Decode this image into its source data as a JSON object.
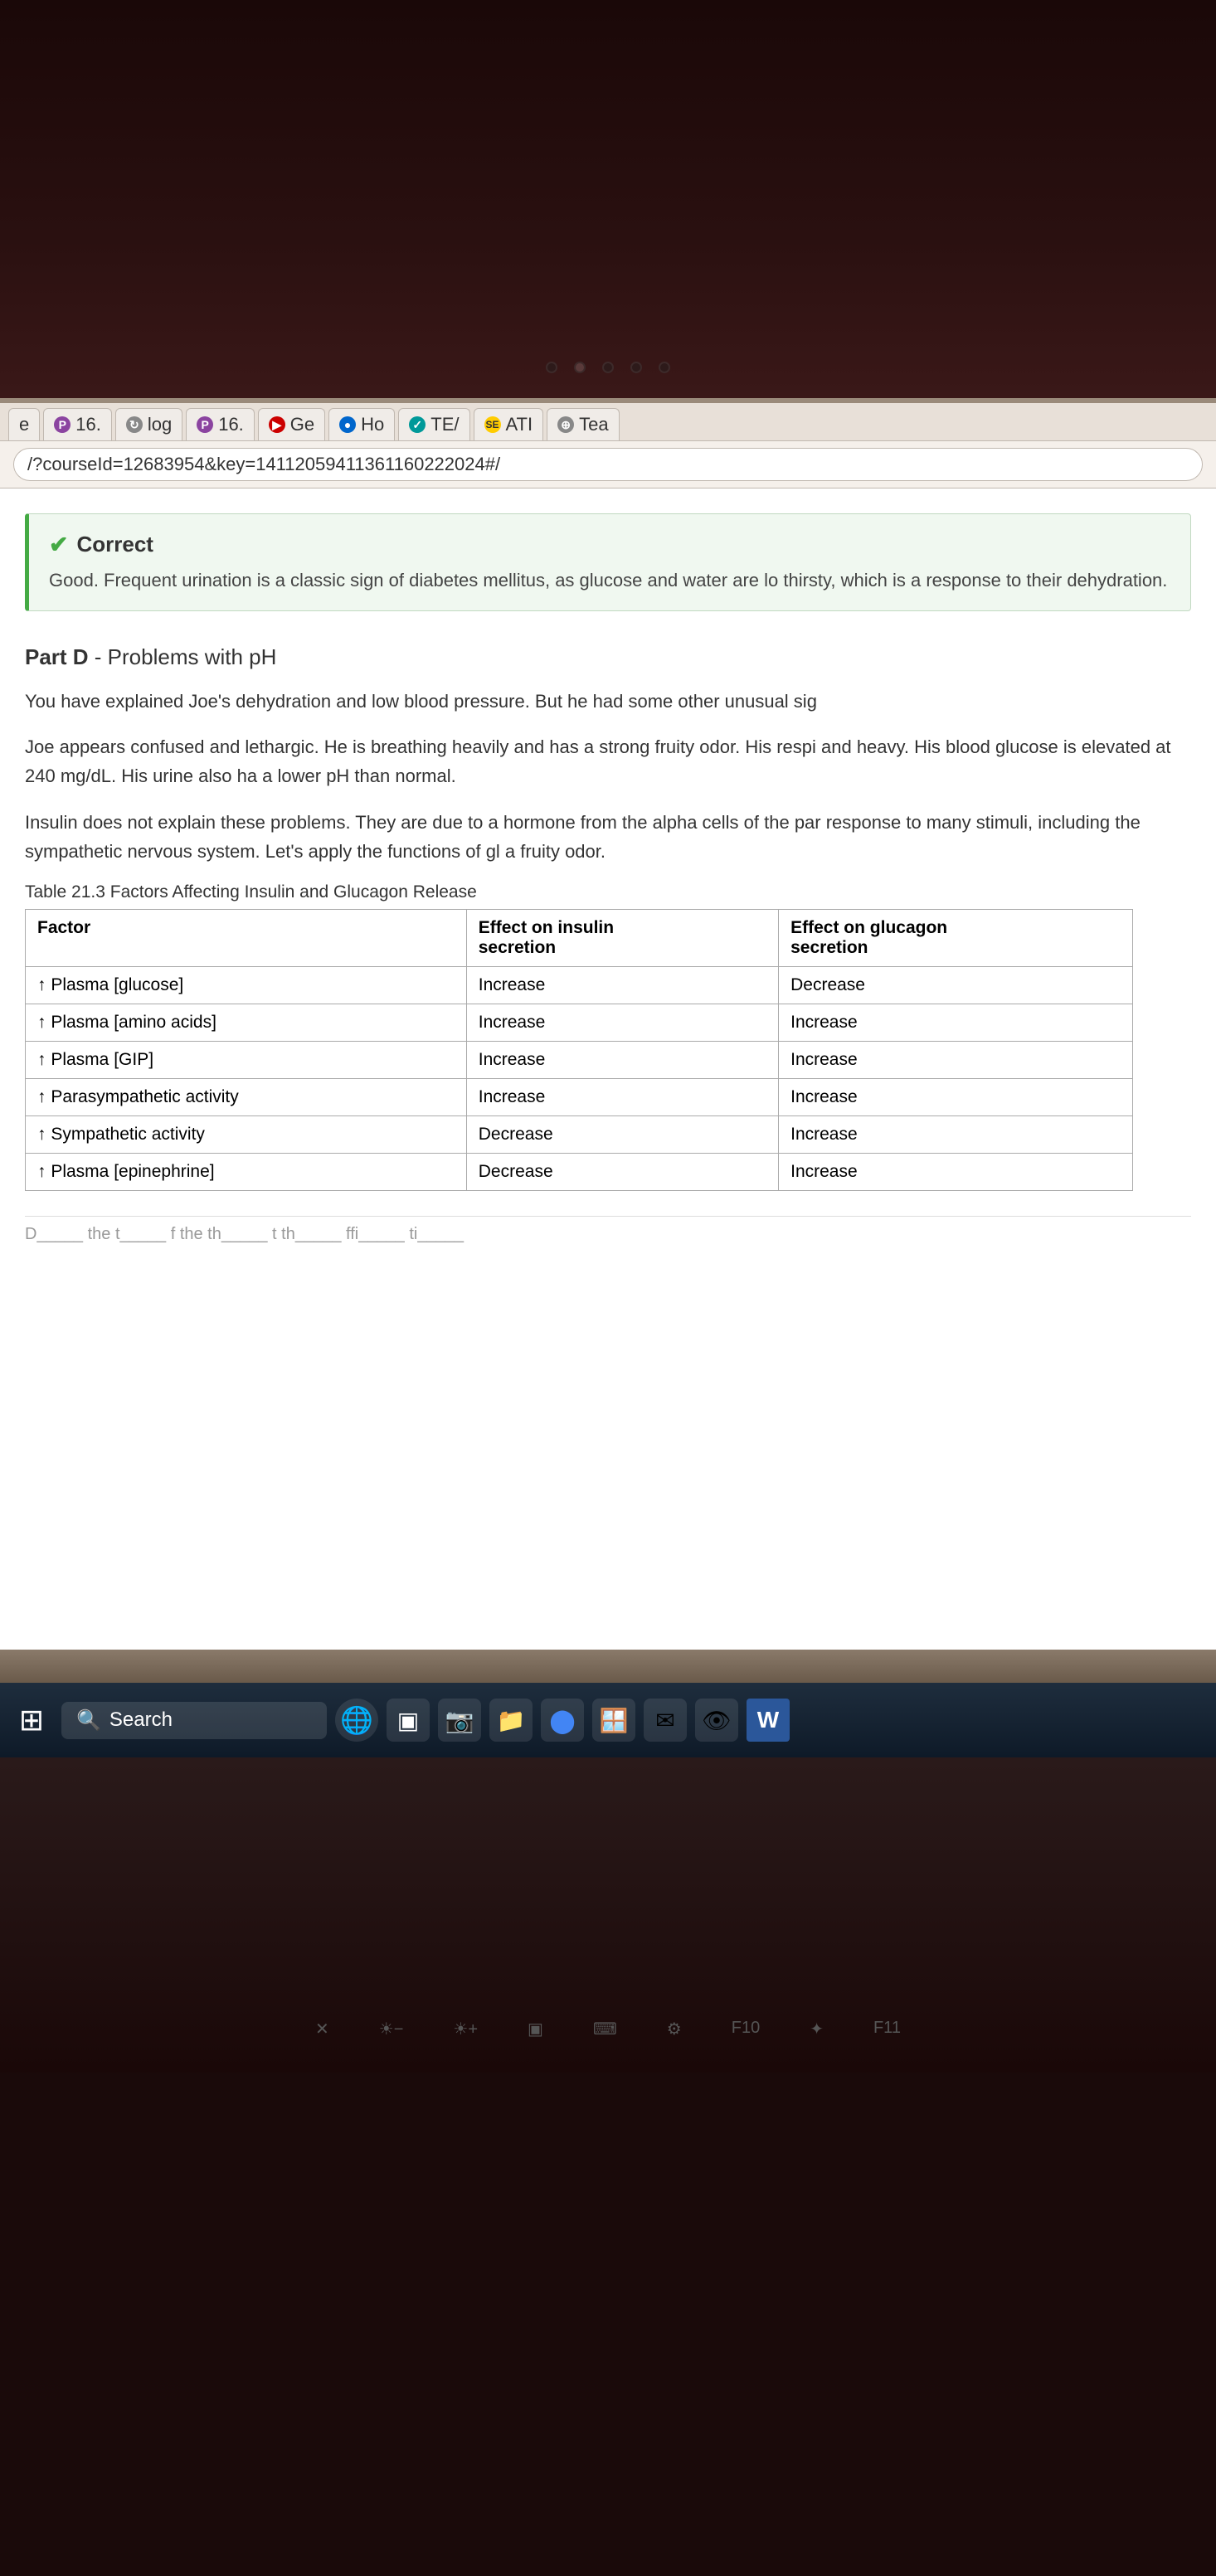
{
  "laptop": {
    "camera_area": "camera"
  },
  "browser": {
    "tabs": [
      {
        "id": "tab-e",
        "label": "e",
        "icon_type": "text",
        "icon_char": "e"
      },
      {
        "id": "tab-p1",
        "label": "16.",
        "icon_type": "purple",
        "icon_char": "P"
      },
      {
        "id": "tab-log",
        "label": "log",
        "icon_type": "globe",
        "icon_char": "↻"
      },
      {
        "id": "tab-p2",
        "label": "16.",
        "icon_type": "purple",
        "icon_char": "P"
      },
      {
        "id": "tab-yt",
        "label": "Ge",
        "icon_type": "red",
        "icon_char": "▶"
      },
      {
        "id": "tab-ho",
        "label": "Ho",
        "icon_type": "blue",
        "icon_char": "●"
      },
      {
        "id": "tab-te",
        "label": "TE/",
        "icon_type": "teal",
        "icon_char": "✓"
      },
      {
        "id": "tab-se",
        "label": "ATI",
        "icon_type": "se",
        "icon_char": "SE"
      },
      {
        "id": "tab-tea",
        "label": "Tea",
        "icon_type": "globe",
        "icon_char": "⊕"
      }
    ],
    "address": "/?courseId=12683954&key=14112059411361160222024#/"
  },
  "correct_banner": {
    "title": "Correct",
    "text": "Good. Frequent urination is a classic sign of diabetes mellitus, as glucose and water are lo thirsty, which is a response to their dehydration."
  },
  "part_d": {
    "heading_bold": "Part D",
    "heading_rest": " - Problems with pH",
    "paragraphs": [
      "You have explained Joe's dehydration and low blood pressure. But he had some other unusual sig",
      "Joe appears confused and lethargic. He is breathing heavily and has a strong fruity odor. His respi and heavy. His blood glucose is elevated at 240 mg/dL. His urine also ha a lower pH than normal.",
      "Insulin does not explain these problems. They are due to a hormone from the alpha cells of the par response to many stimuli, including the sympathetic nervous system. Let's apply the functions of gl a fruity odor."
    ]
  },
  "table": {
    "caption": "Table 21.3 Factors Affecting Insulin and Glucagon Release",
    "headers": [
      "Factor",
      "Effect on insulin secretion",
      "Effect on glucagon secretion"
    ],
    "rows": [
      [
        "↑ Plasma [glucose]",
        "Increase",
        "Decrease"
      ],
      [
        "↑ Plasma [amino acids]",
        "Increase",
        "Increase"
      ],
      [
        "↑ Plasma [GIP]",
        "Increase",
        "Increase"
      ],
      [
        "↑ Parasympathetic activity",
        "Increase",
        "Increase"
      ],
      [
        "↑ Sympathetic activity",
        "Decrease",
        "Increase"
      ],
      [
        "↑ Plasma [epinephrine]",
        "Decrease",
        "Increase"
      ]
    ]
  },
  "partial_bottom": "D the t f the th t th ffi ti",
  "taskbar": {
    "search_placeholder": "Search",
    "icons": [
      {
        "name": "windows",
        "char": "⊞"
      },
      {
        "name": "search-widget",
        "char": "🌐"
      },
      {
        "name": "task-view",
        "char": "▣"
      },
      {
        "name": "video-call",
        "char": "📷"
      },
      {
        "name": "files",
        "char": "📁"
      },
      {
        "name": "chrome",
        "char": "●"
      },
      {
        "name": "store",
        "char": "🪟"
      },
      {
        "name": "mail",
        "char": "✉"
      },
      {
        "name": "security",
        "char": "👁"
      },
      {
        "name": "word",
        "char": "W"
      }
    ]
  }
}
